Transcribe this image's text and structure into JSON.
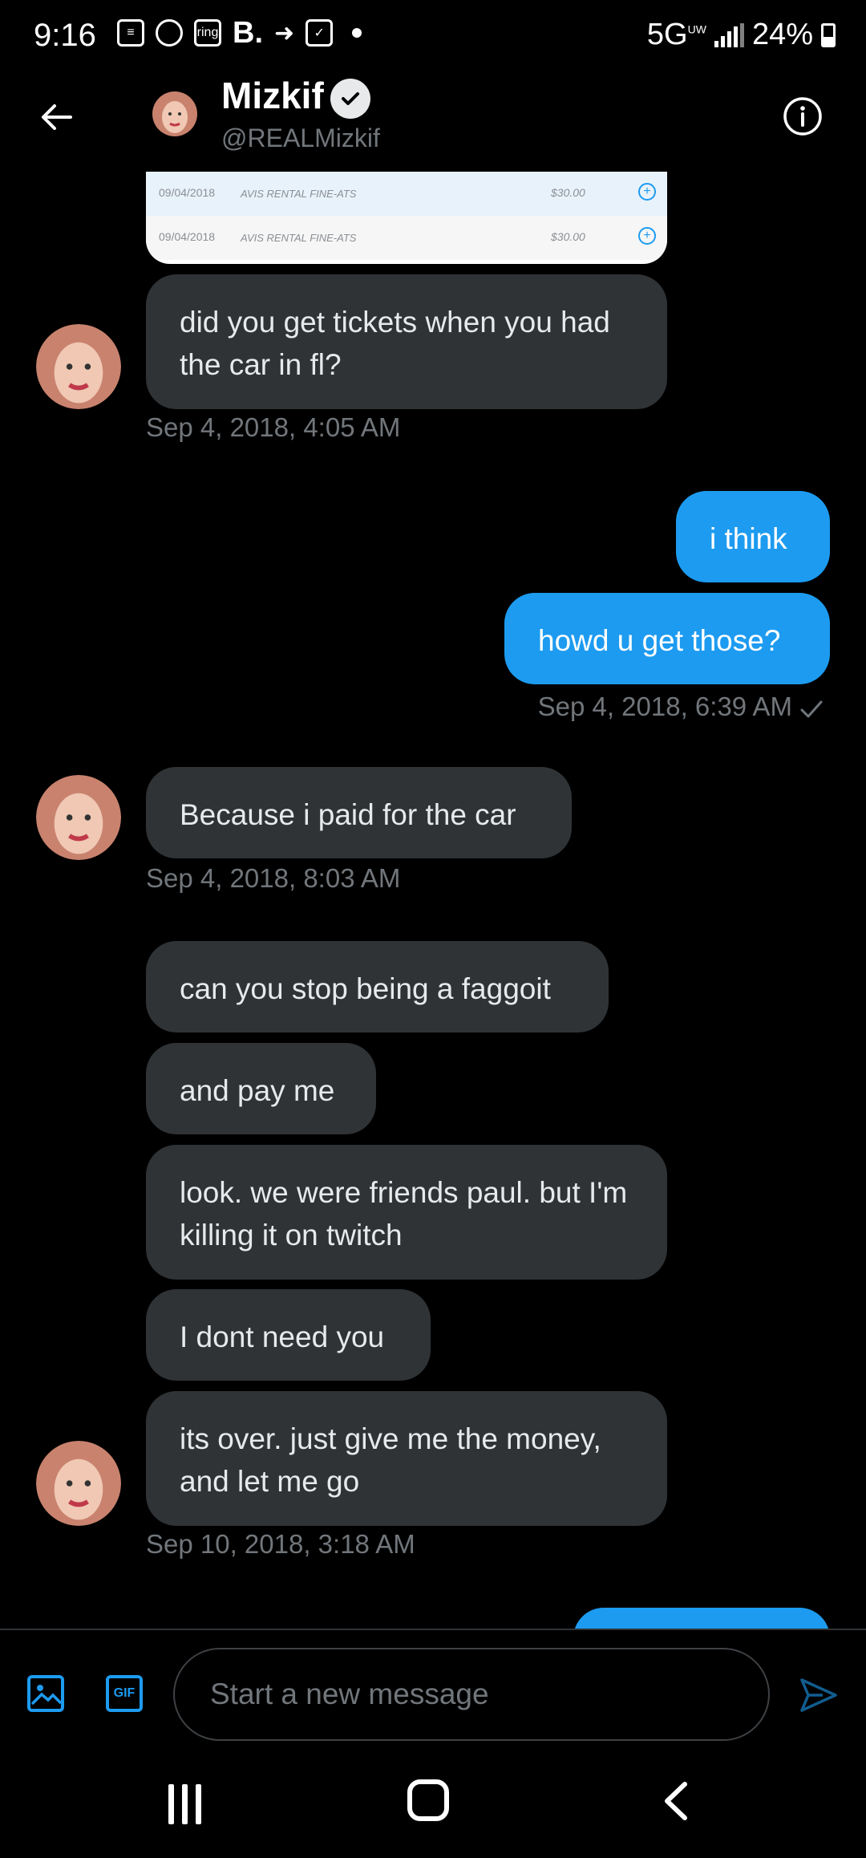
{
  "status_bar": {
    "time": "9:16",
    "network": "5G",
    "network_sub": "UW",
    "battery": "24%",
    "notification_icons": [
      "message-icon",
      "circle-icon",
      "ring-icon",
      "booking-icon",
      "arrow-icon",
      "call-filter-icon"
    ],
    "ring_label": "ring",
    "booking_label": "B."
  },
  "header": {
    "name": "Mizkif",
    "handle": "@REALMizkif",
    "verified": true
  },
  "attachment_card": {
    "rows": [
      {
        "date": "09/04/2018",
        "desc": "AVIS RENTAL FINE-ATS",
        "amount": "$30.00"
      },
      {
        "date": "09/04/2018",
        "desc": "AVIS RENTAL FINE-ATS",
        "amount": "$30.00"
      }
    ]
  },
  "messages": [
    {
      "text": "did you get tickets when you had the car in fl?"
    },
    {
      "timestamp": "Sep 4, 2018, 4:05 AM"
    },
    {
      "text": "i think"
    },
    {
      "text": "howd u get those?"
    },
    {
      "timestamp": "Sep 4, 2018, 6:39 AM"
    },
    {
      "text": "Because i paid for the car"
    },
    {
      "timestamp": "Sep 4, 2018, 8:03 AM"
    },
    {
      "text": "can you stop being a faggoit"
    },
    {
      "text": "and pay me"
    },
    {
      "text": "look. we were friends paul. but I'm killing it on twitch"
    },
    {
      "text": "I dont need you"
    },
    {
      "text": "its over. just give me the money, and let me go"
    },
    {
      "timestamp": "Sep 10, 2018, 3:18 AM"
    }
  ],
  "composer": {
    "placeholder": "Start a new message",
    "gif_label": "GIF"
  },
  "colors": {
    "accent": "#1d9bf0",
    "incoming_bubble": "#2f3336",
    "background": "#000000",
    "muted_text": "#71767b"
  }
}
